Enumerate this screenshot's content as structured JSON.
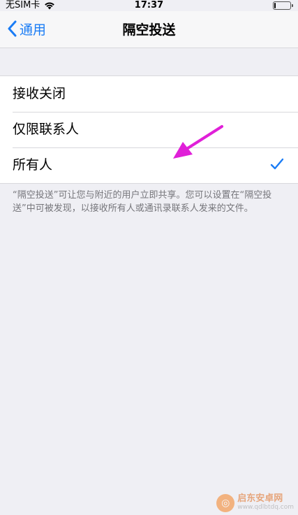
{
  "status_bar": {
    "carrier": "无SIM卡",
    "time": "17:37",
    "battery_level": 0.1
  },
  "nav": {
    "back_label": "通用",
    "title": "隔空投送"
  },
  "options": [
    {
      "label": "接收关闭",
      "selected": false
    },
    {
      "label": "仅限联系人",
      "selected": false
    },
    {
      "label": "所有人",
      "selected": true
    }
  ],
  "footer_note": "“隔空投送”可让您与附近的用户立即共享。您可以设置在“隔空投送”中可被发现，以接收所有人或通讯录联系人发来的文件。",
  "colors": {
    "accent": "#1a7cf5",
    "annotation_arrow": "#e020d8"
  },
  "watermark": {
    "name": "启东安卓网",
    "url": "www.qdlbtdq.com"
  }
}
